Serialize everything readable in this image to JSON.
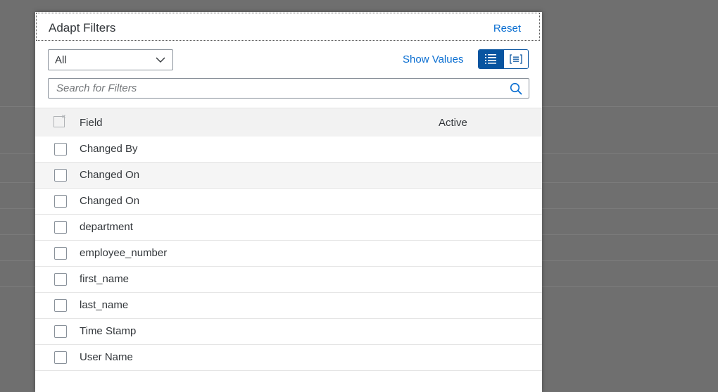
{
  "dialog": {
    "title": "Adapt Filters",
    "reset_label": "Reset"
  },
  "toolbar": {
    "select_value": "All",
    "show_values_label": "Show Values",
    "view_toggle": [
      {
        "icon": "list-icon",
        "active": true
      },
      {
        "icon": "grouped-view-icon",
        "active": false
      }
    ]
  },
  "search": {
    "placeholder": "Search for Filters",
    "icon": "search-icon"
  },
  "table": {
    "headers": {
      "field": "Field",
      "active": "Active"
    },
    "rows": [
      {
        "label": "Changed By",
        "checked": false
      },
      {
        "label": "Changed On",
        "checked": false
      },
      {
        "label": "Changed On",
        "checked": false
      },
      {
        "label": "department",
        "checked": false
      },
      {
        "label": "employee_number",
        "checked": false
      },
      {
        "label": "first_name",
        "checked": false
      },
      {
        "label": "last_name",
        "checked": false
      },
      {
        "label": "Time Stamp",
        "checked": false
      },
      {
        "label": "User Name",
        "checked": false
      }
    ]
  },
  "colors": {
    "accent": "#0a6ed1",
    "toggle_active": "#0854a0",
    "text": "#32363a",
    "overlay": "#6f6f6f"
  }
}
